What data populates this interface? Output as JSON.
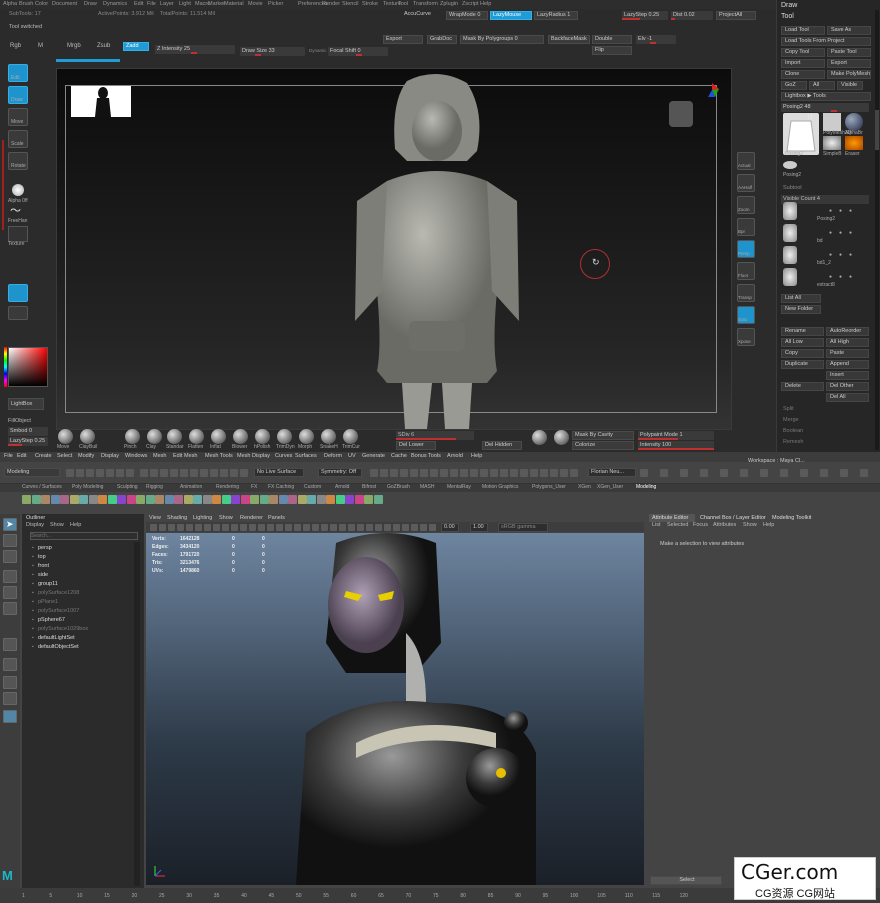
{
  "zbrush": {
    "menu": [
      "Alpha",
      "Brush",
      "Color",
      "Document",
      "Draw",
      "Dynamics",
      "Edit",
      "File",
      "Layer",
      "Light",
      "Macro",
      "Marker",
      "Material",
      "Movie",
      "Picker",
      "Preferences",
      "Render",
      "Stencil",
      "Stroke",
      "Texture",
      "Tool",
      "Transform",
      "Zplugin",
      "Zscript",
      "Help"
    ],
    "subtools": "SubTools: 17",
    "active_points": "ActivePoints: 3.912 Mil",
    "total_points": "TotalPoints: 11.514 Mil",
    "accucurve": "AccuCurve",
    "wrapmode": "WrapMode 0",
    "lazymouse": "LazyMouse",
    "lazyradius": "LazyRadius 1",
    "lazystep": "LazyStep 0.25",
    "dist": "Dist 0.02",
    "projectall": "ProjectAll",
    "status": "Tool switched",
    "rgb": "Rgb",
    "m": "M",
    "mrgb": "Mrgb",
    "zsub": "Zsub",
    "zadd": "Zadd",
    "z_intensity": "Z Intensity 25",
    "draw_size": "Draw Size 33",
    "focal_shift": "Focal Shift 0",
    "dynamic": "Dynamic",
    "export": "Export",
    "grabdoc": "GrabDoc",
    "mask_by_polygroups": "Mask By Polygroups 0",
    "backfacemask": "BackfaceMask",
    "double": "Double",
    "flip": "Flip",
    "elv": "Elv -1",
    "left_tools": [
      "Edit",
      "Draw",
      "Move",
      "Scale",
      "Rotate"
    ],
    "alpha": "Alpha 0ff",
    "freehand": "FreeHan",
    "texture": "Texture",
    "lightbox": "LightBox",
    "fillobject": "FillObject",
    "smbod": "Smbod 0",
    "lazystep2": "LazyStep 0.25",
    "right_icons": [
      "Actual",
      "AAHalf",
      "Zoom",
      "Bpr",
      "Persp",
      "Floor",
      "Transp",
      "Solo",
      "Xpose"
    ],
    "brushes": [
      "Move",
      "ClayBuil",
      "Pinch",
      "Clay",
      "Standar",
      "Flatten",
      "Inflat",
      "Blower",
      "hPolish",
      "TrimDyn",
      "Morph",
      "SnakeH",
      "TrimCur"
    ],
    "sdiv": "SDiv 6",
    "del_lower": "Del Lower",
    "del_hidden": "Del Hidden",
    "mask_by_cavity": "Mask By Cavity",
    "colorize": "Colorize",
    "polypaint_mode": "Polypaint Mode 1",
    "intensity": "Intensity 100",
    "draw_header": "Draw",
    "tool_header": "Tool",
    "tool_buttons": [
      [
        "Load Tool",
        "Save As"
      ],
      [
        "Load Tools From Project",
        ""
      ],
      [
        "Copy Tool",
        "Paste Tool"
      ],
      [
        "Import",
        "Export"
      ],
      [
        "Clone",
        "Make PolyMesh3D"
      ],
      [
        "GoZ",
        "All",
        "Visible"
      ],
      [
        "Lightbox ▶ Tools",
        ""
      ]
    ],
    "posing_slider": "Posing2 48",
    "tool_thumbs": [
      "Posing2",
      "PolyMesh3D",
      "AlphaBr",
      "SimpleB",
      "Eraser"
    ],
    "subtool_header": "Subtool",
    "visible_count": "Visible Count 4",
    "subtools_list": [
      "Posing2",
      "bd",
      "bd1_2",
      "extract8"
    ],
    "list_all": "List All",
    "new_folder": "New Folder",
    "sub_buttons": [
      [
        "Rename",
        "AutoReorder"
      ],
      [
        "All Low",
        "All High"
      ],
      [
        "Copy",
        "Paste"
      ],
      [
        "Duplicate",
        "Append"
      ],
      [
        "",
        "Insert"
      ],
      [
        "Delete",
        "Del Other"
      ],
      [
        "",
        "Del All"
      ]
    ],
    "bottom_items": [
      "Split",
      "Merge",
      "Boolean",
      "Remesh"
    ]
  },
  "maya": {
    "menu": [
      "File",
      "Edit",
      "Create",
      "Select",
      "Modify",
      "Display",
      "Windows",
      "Mesh",
      "Edit Mesh",
      "Mesh Tools",
      "Mesh Display",
      "Curves",
      "Surfaces",
      "Deform",
      "UV",
      "Generate",
      "Cache",
      "Bonus Tools",
      "Arnold",
      "Help"
    ],
    "mode": "Modeling",
    "no_live_surface": "No Live Surface",
    "symmetry": "Symmetry: Off",
    "user": "Florian Neu...",
    "workspace": "Workspace : Maya Cl...",
    "shelf_tabs": [
      "Curves / Surfaces",
      "Poly Modeling",
      "Sculpting",
      "Rigging",
      "Animation",
      "Rendering",
      "FX",
      "FX Caching",
      "Custom",
      "Arnold",
      "Bifrost",
      "GoZBrush",
      "MASH",
      "MentalRay",
      "Motion Graphics",
      "Polygons_User",
      "XGen",
      "XGen_User",
      "Modeling"
    ],
    "outliner_title": "Outliner",
    "outliner_menu": [
      "Display",
      "Show",
      "Help"
    ],
    "search_placeholder": "Search...",
    "outliner_items": [
      {
        "name": "persp",
        "dim": false
      },
      {
        "name": "top",
        "dim": false
      },
      {
        "name": "front",
        "dim": false
      },
      {
        "name": "side",
        "dim": false
      },
      {
        "name": "group11",
        "dim": false
      },
      {
        "name": "polySurface1208",
        "dim": true
      },
      {
        "name": "pPlane1",
        "dim": true
      },
      {
        "name": "polySurface1007",
        "dim": true
      },
      {
        "name": "pSphere67",
        "dim": false
      },
      {
        "name": "polySurface1029box",
        "dim": true
      },
      {
        "name": "defaultLightSet",
        "dim": false
      },
      {
        "name": "defaultObjectSet",
        "dim": false
      }
    ],
    "viewport_menu": [
      "View",
      "Shading",
      "Lighting",
      "Show",
      "Renderer",
      "Panels"
    ],
    "hud": [
      [
        "Verts:",
        "1642128",
        "0",
        "0"
      ],
      [
        "Edges:",
        "3434120",
        "0",
        "0"
      ],
      [
        "Faces:",
        "1791720",
        "0",
        "0"
      ],
      [
        "Tris:",
        "3213476",
        "0",
        "0"
      ],
      [
        "UVs:",
        "1479860",
        "0",
        "0"
      ]
    ],
    "field1": "0.00",
    "field2": "1.00",
    "colorspace": "sRGB gamma",
    "ae_tabs": [
      "Attribute Editor",
      "Channel Box / Layer Editor",
      "Modeling Toolkit"
    ],
    "ae_menu": [
      "List",
      "Selected",
      "Focus",
      "Attributes",
      "Show",
      "Help"
    ],
    "ae_message": "Make a selection to view attributes",
    "ae_select": "Select",
    "timeline_numbers": [
      "1",
      "5",
      "10",
      "15",
      "20",
      "25",
      "30",
      "35",
      "40",
      "45",
      "50",
      "55",
      "60",
      "65",
      "70",
      "75",
      "80",
      "85",
      "90",
      "95",
      "100",
      "105",
      "110",
      "115",
      "120"
    ],
    "watermark": "CGer.com",
    "watermark_sub": "CG资源 CG网站"
  }
}
